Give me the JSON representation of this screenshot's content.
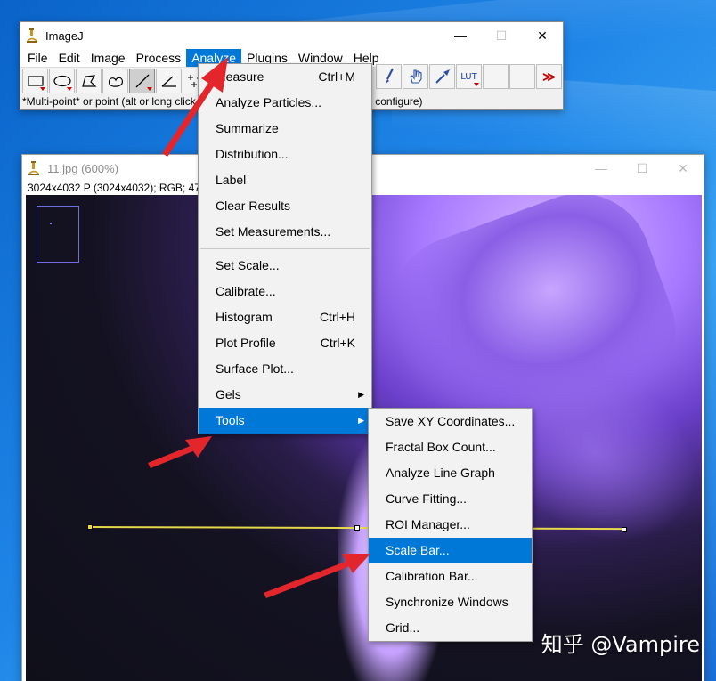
{
  "main_window": {
    "title": "ImageJ",
    "controls": {
      "minimize": "—",
      "maximize": "☐",
      "close": "✕"
    },
    "menus": [
      "File",
      "Edit",
      "Image",
      "Process",
      "Analyze",
      "Plugins",
      "Window",
      "Help"
    ],
    "active_menu": "Analyze",
    "toolbar": {
      "lut_label": "LUT",
      "more_label": "≫",
      "tools": [
        "rectangle-tool",
        "oval-tool",
        "polygon-tool",
        "freehand-tool",
        "line-tool",
        "angle-tool",
        "multipoint-tool"
      ]
    },
    "status": "*Multi-point* or point (alt or long click to switch to point tool, double click to configure)"
  },
  "image_window": {
    "title": "11.jpg (600%)",
    "info": "3024x4032 P (3024x4032); RGB; 47"
  },
  "analyze_menu": {
    "items": [
      {
        "label": "Measure",
        "shortcut": "Ctrl+M"
      },
      {
        "label": "Analyze Particles...",
        "shortcut": ""
      },
      {
        "label": "Summarize",
        "shortcut": ""
      },
      {
        "label": "Distribution...",
        "shortcut": ""
      },
      {
        "label": "Label",
        "shortcut": ""
      },
      {
        "label": "Clear Results",
        "shortcut": ""
      },
      {
        "label": "Set Measurements...",
        "shortcut": ""
      },
      {
        "label": "Set Scale...",
        "shortcut": ""
      },
      {
        "label": "Calibrate...",
        "shortcut": ""
      },
      {
        "label": "Histogram",
        "shortcut": "Ctrl+H"
      },
      {
        "label": "Plot Profile",
        "shortcut": "Ctrl+K"
      },
      {
        "label": "Surface Plot...",
        "shortcut": ""
      },
      {
        "label": "Gels",
        "shortcut": "",
        "submenu": true
      },
      {
        "label": "Tools",
        "shortcut": "",
        "submenu": true
      }
    ],
    "highlighted": "Tools"
  },
  "tools_menu": {
    "items": [
      "Save XY Coordinates...",
      "Fractal Box Count...",
      "Analyze Line Graph",
      "Curve Fitting...",
      "ROI Manager...",
      "Scale Bar...",
      "Calibration Bar...",
      "Synchronize Windows",
      "Grid..."
    ],
    "highlighted": "Scale Bar..."
  },
  "watermark": "知乎 @Vampire",
  "colors": {
    "accent": "#0078d7",
    "annotation_arrow": "#e3262b",
    "line_roi": "#e6d84a"
  }
}
